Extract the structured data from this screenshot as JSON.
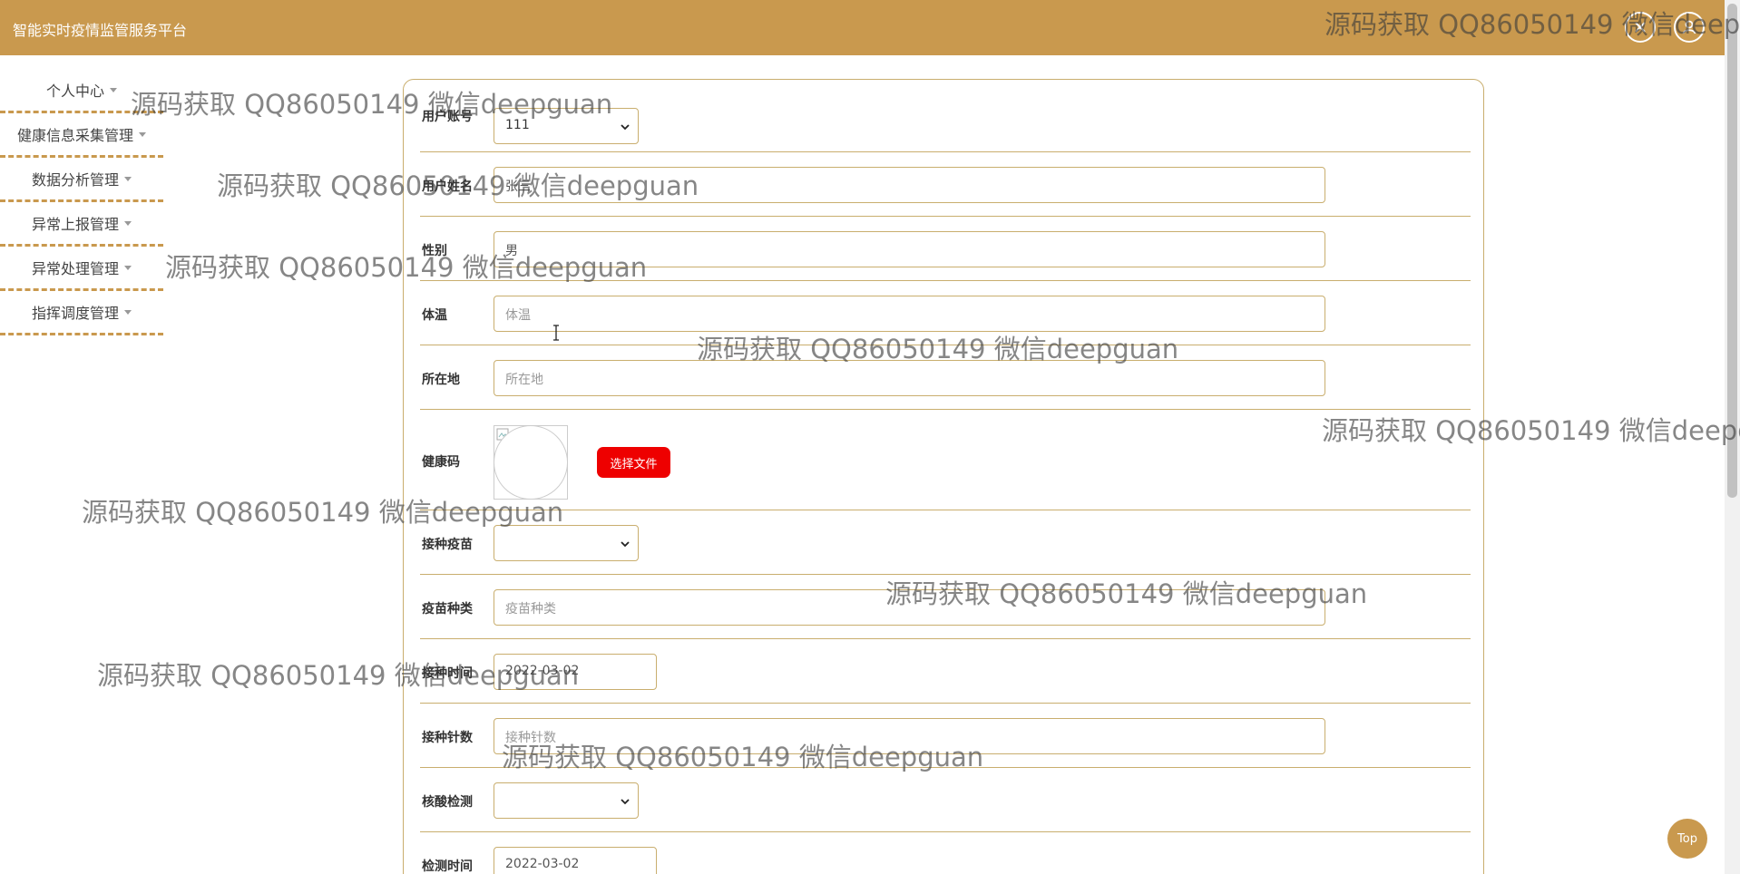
{
  "header": {
    "title": "智能实时疫情监管服务平台"
  },
  "sidebar": {
    "items": [
      {
        "label": "个人中心"
      },
      {
        "label": "健康信息采集管理"
      },
      {
        "label": "数据分析管理"
      },
      {
        "label": "异常上报管理"
      },
      {
        "label": "异常处理管理"
      },
      {
        "label": "指挥调度管理"
      }
    ]
  },
  "form": {
    "account": {
      "label": "用户账号",
      "value": "111"
    },
    "name": {
      "label": "用户姓名",
      "value": "张三"
    },
    "gender": {
      "label": "性别",
      "value": "男"
    },
    "temperature": {
      "label": "体温",
      "placeholder": "体温"
    },
    "location": {
      "label": "所在地",
      "placeholder": "所在地"
    },
    "health_code": {
      "label": "健康码",
      "button": "选择文件"
    },
    "vaccinated": {
      "label": "接种疫苗",
      "value": ""
    },
    "vaccine_type": {
      "label": "疫苗种类",
      "placeholder": "疫苗种类"
    },
    "vaccination_time": {
      "label": "接种时间",
      "value": "2022-03-02"
    },
    "vaccine_doses": {
      "label": "接种针数",
      "placeholder": "接种针数"
    },
    "nucleic_test": {
      "label": "核酸检测",
      "value": ""
    },
    "test_time": {
      "label": "检测时间",
      "value": "2022-03-02"
    }
  },
  "top_button": {
    "label": "Top"
  },
  "watermark": {
    "text": "源码获取 QQ86050149 微信deepguan"
  },
  "colors": {
    "brand": "#c9994e",
    "danger": "#ee0000"
  }
}
